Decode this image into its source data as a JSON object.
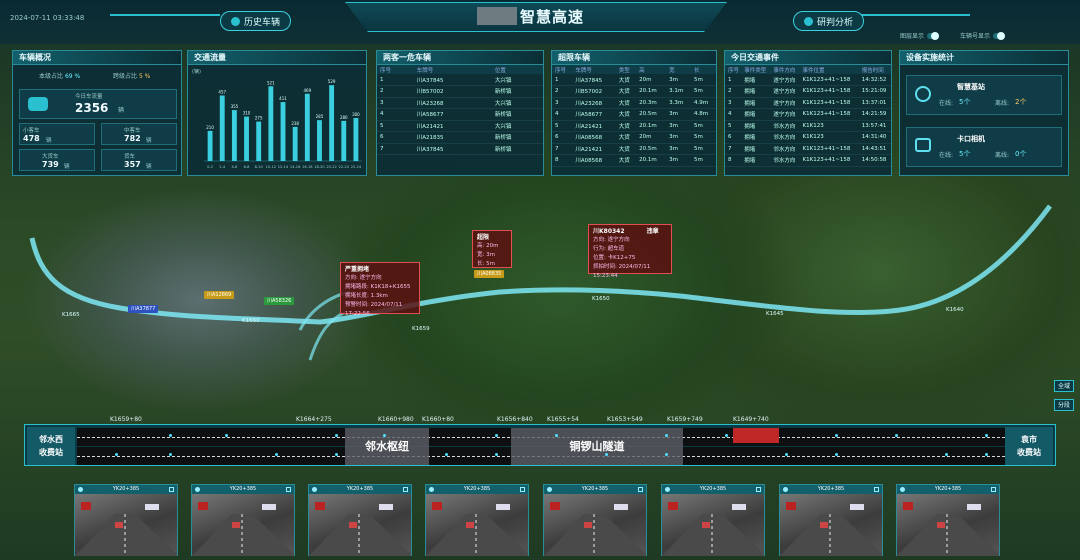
{
  "header": {
    "datetime": "2024-07-11  03:33:48",
    "title": "智慧高速",
    "history_button": "历史车辆",
    "analysis_button": "研判分析",
    "toggles": [
      "图层显示",
      "车辆号显示"
    ]
  },
  "vehicle_stats": {
    "title": "车辆概况",
    "top_left_label": "本级占比",
    "top_left_value": "69 %",
    "top_right_label": "跨级占比",
    "top_right_value": "5 %",
    "total_label": "今日车流量",
    "total_value": "2356",
    "total_unit": "辆",
    "cards": [
      {
        "label": "小客车",
        "value": "478",
        "unit": "辆"
      },
      {
        "label": "中客车",
        "value": "782",
        "unit": "辆"
      },
      {
        "label": "大货车",
        "value": "739",
        "unit": "辆"
      },
      {
        "label": "货车",
        "value": "357",
        "unit": "辆"
      }
    ]
  },
  "traffic_flow": {
    "title": "交通流量",
    "y_unit": "(辆)",
    "chart_data": {
      "type": "bar",
      "title": "交通流量",
      "ylabel": "(辆)",
      "categories": [
        "0-2",
        "2-4",
        "4-6",
        "6-8",
        "8-10",
        "10-12",
        "12-14",
        "14-16",
        "16-18",
        "18-20",
        "20-22",
        "22-24",
        "22-24"
      ],
      "values": [
        210,
        457,
        355,
        310,
        275,
        521,
        411,
        238,
        469,
        285,
        529,
        280,
        300
      ],
      "ylim": [
        0,
        600
      ],
      "grid": false,
      "color": "#3ad0e0"
    }
  },
  "recent_vehicles": {
    "title": "两客一危车辆",
    "headers": [
      "序号",
      "车牌号",
      "位置"
    ],
    "rows": [
      [
        "1",
        "川A37845",
        "大兴镇"
      ],
      [
        "2",
        "川B57002",
        "新桥镇"
      ],
      [
        "3",
        "川A23268",
        "大兴镇"
      ],
      [
        "4",
        "川A58677",
        "新桥镇"
      ],
      [
        "5",
        "川A21421",
        "大兴镇"
      ],
      [
        "6",
        "川A21835",
        "新桥镇"
      ],
      [
        "7",
        "川A37845",
        "新桥镇"
      ]
    ]
  },
  "overlimit_vehicles": {
    "title": "超限车辆",
    "headers": [
      "序号",
      "车牌号",
      "类型",
      "高",
      "宽",
      "长"
    ],
    "rows": [
      [
        "1",
        "川A37845",
        "大货",
        "20m",
        "3m",
        "5m"
      ],
      [
        "2",
        "川B57002",
        "大货",
        "20.1m",
        "3.1m",
        "5m"
      ],
      [
        "3",
        "川A23268",
        "大货",
        "20.3m",
        "3.3m",
        "4.9m"
      ],
      [
        "4",
        "川A58677",
        "大货",
        "20.5m",
        "3m",
        "4.8m"
      ],
      [
        "5",
        "川A21421",
        "大货",
        "20.1m",
        "3m",
        "5m"
      ],
      [
        "6",
        "川A08568",
        "大货",
        "20m",
        "3m",
        "5m"
      ],
      [
        "7",
        "川A21421",
        "大货",
        "20.5m",
        "3m",
        "5m"
      ],
      [
        "8",
        "川A08568",
        "大货",
        "20.1m",
        "3m",
        "5m"
      ]
    ]
  },
  "events": {
    "title": "今日交通事件",
    "headers": [
      "序号",
      "事件类型",
      "事件方向",
      "事件位置",
      "报告时间"
    ],
    "rows": [
      [
        "1",
        "拥堵",
        "遂宁方向",
        "K1K123+41~158",
        "14:32:52"
      ],
      [
        "2",
        "拥堵",
        "遂宁方向",
        "K1K123+41~158",
        "15:21:09"
      ],
      [
        "3",
        "拥堵",
        "遂宁方向",
        "K1K123+41~158",
        "13:37:01"
      ],
      [
        "4",
        "拥堵",
        "遂宁方向",
        "K1K123+41~158",
        "14:21:59"
      ],
      [
        "5",
        "拥堵",
        "邻水方向",
        "K1K123",
        "13:57:41"
      ],
      [
        "6",
        "拥堵",
        "邻水方向",
        "K1K123",
        "14:31:40"
      ],
      [
        "7",
        "拥堵",
        "邻水方向",
        "K1K123+41~158",
        "14:43:51"
      ],
      [
        "8",
        "拥堵",
        "邻水方向",
        "K1K123+41~158",
        "14:50:58"
      ]
    ]
  },
  "device_stats": {
    "title": "设备实施统计",
    "items": [
      {
        "name": "智慧基站",
        "online_label": "在线:",
        "online": "5个",
        "offline_label": "离线:",
        "offline": "2个"
      },
      {
        "name": "卡口相机",
        "online_label": "在线:",
        "online": "5个",
        "offline_label": "离线:",
        "offline": "0个"
      }
    ]
  },
  "map": {
    "popups": [
      {
        "title": "严重拥堵",
        "lines": [
          "方向: 遂宁方向",
          "拥堵路段: K1K18+K1655",
          "拥堵长度: 1.3km",
          "预警时间: 2024/07/11 17:22:56"
        ]
      },
      {
        "title": "超限",
        "lines": [
          "高: 20m",
          "宽: 3m",
          "长: 5m"
        ],
        "plate": "川A08835"
      },
      {
        "title": "川K80342",
        "badge": "违章",
        "lines": [
          "方向: 遂宁方向",
          "行为: 超车道",
          "位置: 卡K12+75",
          "抓拍时间: 2024/07/11 15:23:44"
        ]
      }
    ],
    "vehicle_tags": [
      "川A37877",
      "川A12869",
      "川A58326"
    ],
    "km_labels": [
      "K1665",
      "K1660",
      "K1659",
      "K1650",
      "K1645",
      "K1640"
    ],
    "side_buttons": [
      "全域",
      "分段"
    ]
  },
  "road": {
    "left_station": "邻水西\n收费站",
    "right_station": "袁市\n收费站",
    "segments": [
      "邻水枢纽",
      "铜锣山隧道"
    ],
    "piles": [
      "K1659+80",
      "K1664+275",
      "K1660+980",
      "K1660+80",
      "K1656+840",
      "K1655+54",
      "K1653+549",
      "K1659+749",
      "K1649+740"
    ]
  },
  "cameras": [
    "YK20+385",
    "YK20+385",
    "YK20+385",
    "YK20+385",
    "YK20+385",
    "YK20+385",
    "YK20+385",
    "YK20+385"
  ]
}
